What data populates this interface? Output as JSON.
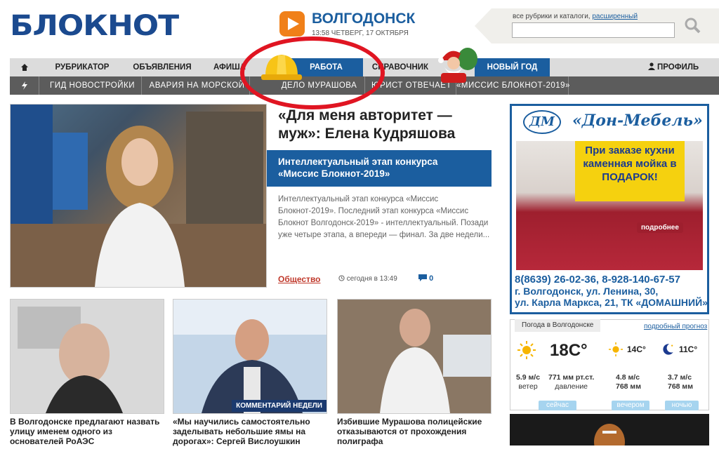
{
  "header": {
    "logo_text": "БЛОКНОТ",
    "city": "ВОЛГОДОНСК",
    "date": "13:58 ЧЕТВЕРГ, 17 ОКТЯБРЯ",
    "search_label": "все рубрики и каталоги, ",
    "search_advanced": "расширенный",
    "search_placeholder": ""
  },
  "nav_primary": [
    "РУБРИКАТОР",
    "ОБЪЯВЛЕНИЯ",
    "АФИША",
    "РАБОТА",
    "СПРАВОЧНИК",
    "НОВЫЙ ГОД",
    "ПРОФИЛЬ"
  ],
  "nav_secondary": [
    "ГИД НОВОСТРОЙКИ",
    "АВАРИЯ НА МОРСКОЙ",
    "ДЕЛО МУРАШОВА",
    "ЮРИСТ ОТВЕЧАЕТ",
    "«МИССИС БЛОКНОТ-2019»"
  ],
  "main_story": {
    "title": "«Для меня авторитет — муж»: Елена Кудряшова",
    "banner": "Интеллектуальный этап конкурса «Миссис Блокнот-2019»",
    "text": "Интеллектуальный этап конкурса «Миссис Блокнот-2019». Последний этап конкурса «Миссис Блокнот Волгодонск-2019» - интеллектуальный. Позади уже четыре этапа, а впереди — финал. За две недели...",
    "category": "Общество",
    "time": "сегодня в 13:49",
    "comments": "0"
  },
  "thumbs": [
    {
      "title": "В Волгодонске предлагают назвать улицу именем одного из основателей РоАЭС"
    },
    {
      "title": "«Мы научились самостоятельно заделывать небольшие ямы на дорогах»: Сергей Вислоушкин",
      "badge": "КОММЕНТАРИЙ НЕДЕЛИ"
    },
    {
      "title": "Избившие Мурашова полицейские отказываются от прохождения полиграфа"
    }
  ],
  "ad": {
    "logo": "ДМ",
    "name": "«Дон-Мебель»",
    "promo": "При заказе кухни каменная мойка в ПОДАРОК!",
    "more": "подробнее",
    "phones": "8(8639) 26-02-36, 8-928-140-67-57",
    "address1": "г. Волгодонск, ул. Ленина, 30,",
    "address2": "ул. Карла Маркса, 21, ТК «ДОМАШНИЙ»"
  },
  "weather": {
    "label": "Погода в Волгодонске",
    "link": "подробный прогноз",
    "now": {
      "temp": "18C°",
      "wind": "5.9 м/с",
      "wind_label": "ветер",
      "pressure": "771 мм рт.ст.",
      "pressure_label": "давление",
      "button": "сейчас"
    },
    "evening": {
      "temp": "14C°",
      "wind": "4.8 м/с",
      "pressure": "768 мм",
      "button": "вечером"
    },
    "night": {
      "temp": "11C°",
      "wind": "3.7 м/с",
      "pressure": "768 мм",
      "button": "ночью"
    }
  },
  "colors": {
    "brand_blue": "#1b5e9f",
    "nav_gray": "#dcdcdc",
    "nav_dark": "#5c5c5c",
    "accent_red": "#e01522",
    "orange": "#f08019"
  }
}
